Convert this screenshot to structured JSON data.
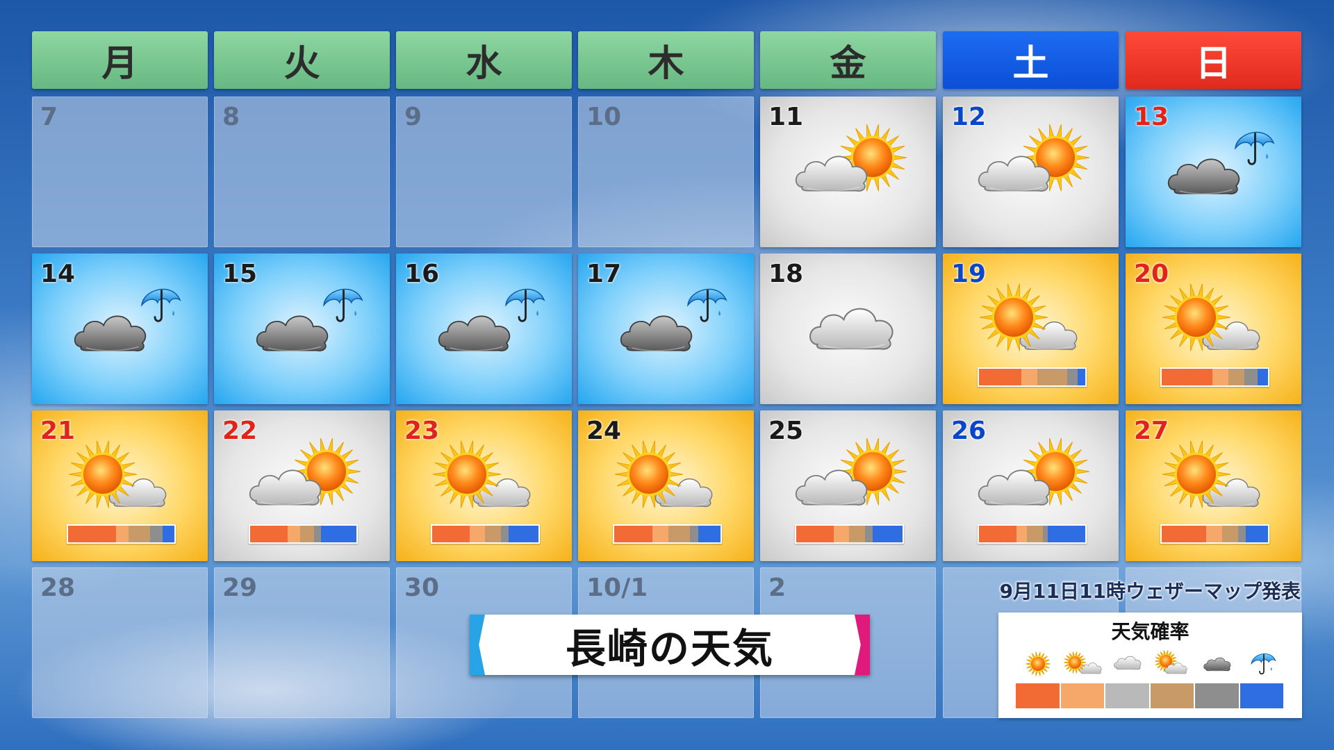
{
  "title": "長崎の天気",
  "issued": "9月11日11時ウェザーマップ発表",
  "weekdays": [
    {
      "label": "月",
      "kind": "weekday"
    },
    {
      "label": "火",
      "kind": "weekday"
    },
    {
      "label": "水",
      "kind": "weekday"
    },
    {
      "label": "木",
      "kind": "weekday"
    },
    {
      "label": "金",
      "kind": "weekday"
    },
    {
      "label": "土",
      "kind": "saturday"
    },
    {
      "label": "日",
      "kind": "sunday"
    }
  ],
  "colors": {
    "sunny": "#f26b35",
    "sunny_cloudy": "#f5a86a",
    "cloudy": "#b9b9b9",
    "cloudy_sunny": "#c89a68",
    "cloudy_rain": "#8e8e8e",
    "rain": "#2f6ee2"
  },
  "days": [
    {
      "day": "7",
      "bg": "empty",
      "color": "e"
    },
    {
      "day": "8",
      "bg": "empty",
      "color": "e"
    },
    {
      "day": "9",
      "bg": "empty",
      "color": "e"
    },
    {
      "day": "10",
      "bg": "empty",
      "color": "e"
    },
    {
      "day": "11",
      "bg": "gray",
      "color": "k",
      "icon": "cloudy_sunny"
    },
    {
      "day": "12",
      "bg": "gray",
      "color": "b",
      "icon": "cloudy_sunny"
    },
    {
      "day": "13",
      "bg": "blue",
      "color": "r",
      "icon": "cloudy_rain"
    },
    {
      "day": "14",
      "bg": "blue",
      "color": "k",
      "icon": "cloudy_rain"
    },
    {
      "day": "15",
      "bg": "blue",
      "color": "k",
      "icon": "cloudy_rain"
    },
    {
      "day": "16",
      "bg": "blue",
      "color": "k",
      "icon": "cloudy_rain"
    },
    {
      "day": "17",
      "bg": "blue",
      "color": "k",
      "icon": "cloudy_rain"
    },
    {
      "day": "18",
      "bg": "gray",
      "color": "k",
      "icon": "cloudy"
    },
    {
      "day": "19",
      "bg": "yellow",
      "color": "b",
      "icon": "sunny_cloudy",
      "prob": [
        40,
        15,
        0,
        28,
        10,
        7
      ]
    },
    {
      "day": "20",
      "bg": "yellow",
      "color": "r",
      "icon": "sunny_cloudy",
      "prob": [
        48,
        15,
        0,
        15,
        12,
        10
      ]
    },
    {
      "day": "21",
      "bg": "yellow",
      "color": "r",
      "icon": "sunny_cloudy",
      "prob": [
        45,
        12,
        0,
        20,
        12,
        11
      ]
    },
    {
      "day": "22",
      "bg": "gray",
      "color": "r",
      "icon": "cloudy_sunny",
      "prob": [
        35,
        12,
        0,
        13,
        7,
        33
      ]
    },
    {
      "day": "23",
      "bg": "yellow",
      "color": "r",
      "icon": "sunny_cloudy",
      "prob": [
        35,
        15,
        0,
        15,
        7,
        28
      ]
    },
    {
      "day": "24",
      "bg": "yellow",
      "color": "k",
      "icon": "sunny_cloudy",
      "prob": [
        36,
        15,
        0,
        20,
        8,
        21
      ]
    },
    {
      "day": "25",
      "bg": "gray",
      "color": "k",
      "icon": "cloudy_sunny",
      "prob": [
        35,
        15,
        0,
        15,
        7,
        28
      ]
    },
    {
      "day": "26",
      "bg": "gray",
      "color": "b",
      "icon": "cloudy_sunny",
      "prob": [
        35,
        10,
        0,
        15,
        5,
        35
      ]
    },
    {
      "day": "27",
      "bg": "yellow",
      "color": "r",
      "icon": "sunny_cloudy",
      "prob": [
        42,
        15,
        0,
        15,
        7,
        21
      ]
    },
    {
      "day": "28",
      "bg": "empty",
      "color": "e"
    },
    {
      "day": "29",
      "bg": "empty",
      "color": "e"
    },
    {
      "day": "30",
      "bg": "empty",
      "color": "e"
    },
    {
      "day": "10/1",
      "bg": "empty",
      "color": "e"
    },
    {
      "day": "2",
      "bg": "empty",
      "color": "e"
    },
    {
      "day": "",
      "bg": "empty",
      "color": "e"
    },
    {
      "day": "",
      "bg": "empty",
      "color": "e"
    }
  ],
  "legend": {
    "title": "天気確率",
    "items": [
      {
        "icon": "sunny",
        "color": "#f26b35"
      },
      {
        "icon": "sunny_cloudy",
        "color": "#f5a86a"
      },
      {
        "icon": "cloudy",
        "color": "#b9b9b9"
      },
      {
        "icon": "cloudy_sunny",
        "color": "#c89a68"
      },
      {
        "icon": "cloudy_gray",
        "color": "#8e8e8e"
      },
      {
        "icon": "rain",
        "color": "#2f6ee2"
      }
    ]
  }
}
